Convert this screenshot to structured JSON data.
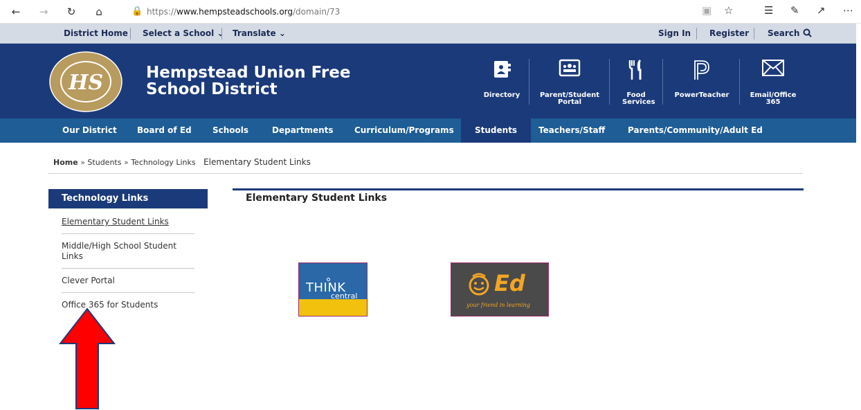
{
  "browser": {
    "url_scheme": "https://",
    "url_host": "www.hempsteadschools.org",
    "url_path": "/domain/73"
  },
  "utility": {
    "district_home": "District Home",
    "select_school": "Select a School",
    "translate": "Translate",
    "sign_in": "Sign In",
    "register": "Register",
    "search": "Search"
  },
  "header": {
    "title": "Hempstead Union Free School District",
    "quick_links": [
      {
        "label": "Directory",
        "icon": "directory-icon"
      },
      {
        "label": "Parent/Student Portal",
        "icon": "portal-icon"
      },
      {
        "label": "Food Services",
        "icon": "fork-knife-icon"
      },
      {
        "label": "PowerTeacher",
        "icon": "powerteacher-icon"
      },
      {
        "label": "Email/Office 365",
        "icon": "envelope-icon"
      }
    ]
  },
  "nav": {
    "items": [
      "Our District",
      "Board of Ed",
      "Schools",
      "Departments",
      "Curriculum/Programs",
      "Students",
      "Teachers/Staff",
      "Parents/Community/Adult Ed"
    ],
    "active": "Students"
  },
  "breadcrumb": {
    "home": "Home",
    "sep": "»",
    "students": "Students",
    "tech_links": "Technology Links",
    "current": "Elementary Student Links"
  },
  "sidebar": {
    "heading": "Technology Links",
    "items": [
      "Elementary Student Links",
      "Middle/High School Student Links",
      "Clever Portal",
      "Office 365 for Students"
    ]
  },
  "content": {
    "title": "Elementary Student Links",
    "think_central_top": "THINK",
    "think_central_bottom": "central",
    "ed_logo": "Ed",
    "ed_tagline": "your friend in learning"
  },
  "colors": {
    "header_blue": "#1b3a7a",
    "nav_blue": "#1e5d96",
    "annotation_arrow": "#ff0000"
  }
}
